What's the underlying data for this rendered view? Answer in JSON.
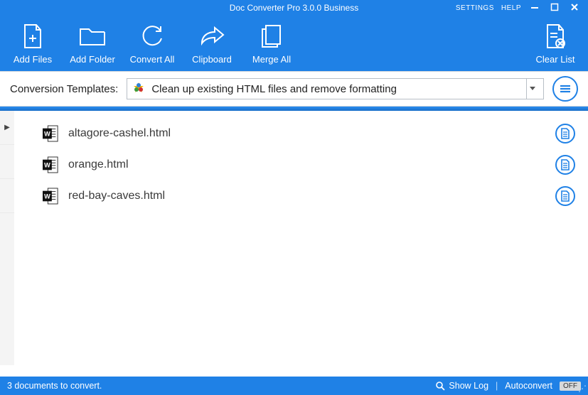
{
  "title": "Doc Converter Pro 3.0.0 Business",
  "titlebar": {
    "settings": "SETTINGS",
    "help": "HELP"
  },
  "toolbar": {
    "add_files": "Add Files",
    "add_folder": "Add Folder",
    "convert_all": "Convert All",
    "clipboard": "Clipboard",
    "merge_all": "Merge All",
    "clear_list": "Clear List"
  },
  "templates": {
    "label": "Conversion Templates:",
    "selected": "Clean up existing HTML files and remove formatting"
  },
  "files": [
    {
      "name": "altagore-cashel.html"
    },
    {
      "name": "orange.html"
    },
    {
      "name": "red-bay-caves.html"
    }
  ],
  "status": {
    "count_text": "3 documents to convert.",
    "show_log": "Show Log",
    "autoconvert": "Autoconvert",
    "autoconvert_state": "OFF"
  }
}
